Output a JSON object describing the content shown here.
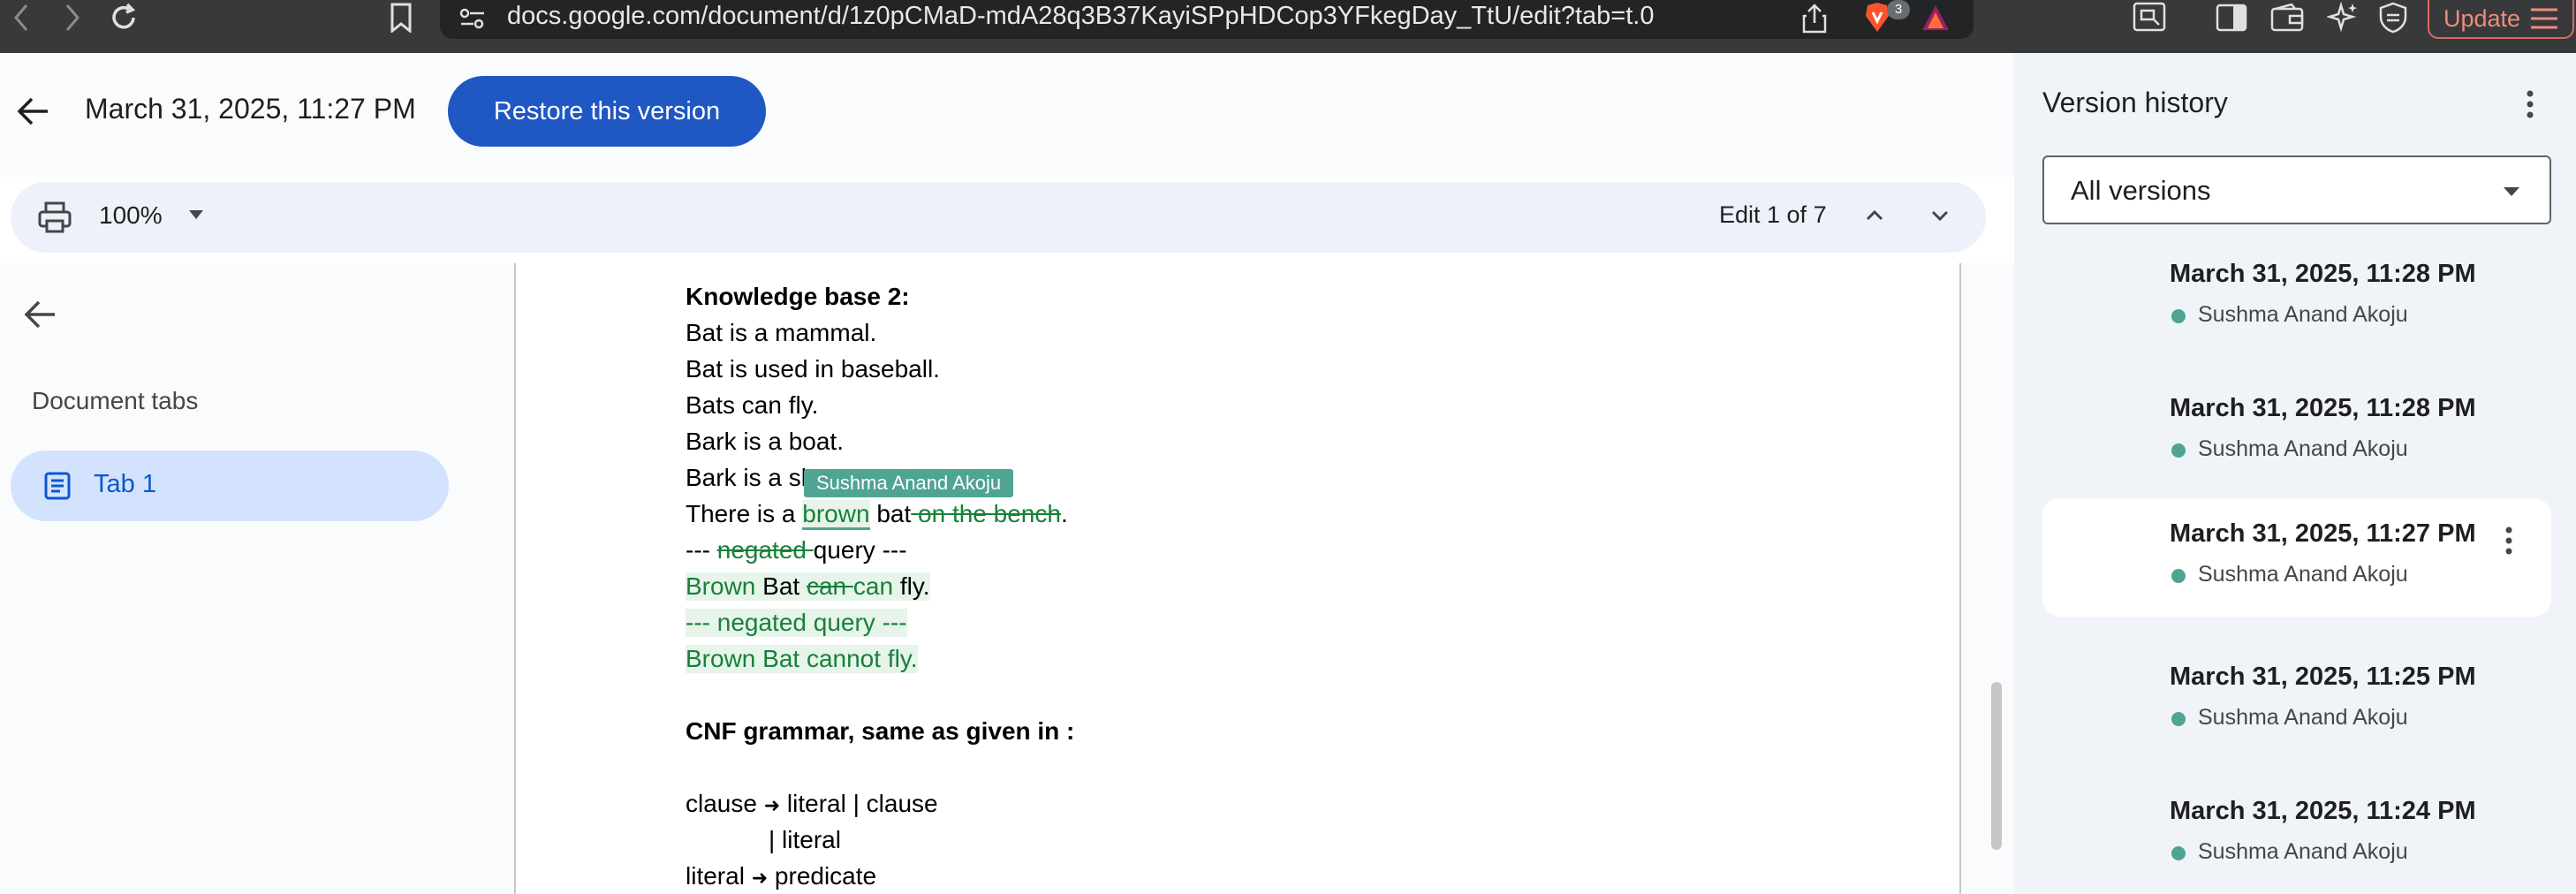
{
  "browser": {
    "url": "docs.google.com/document/d/1z0pCMaD-mdA28q3B37KayiSPpHDCop3YFkegDay_TtU/edit?tab=t.0",
    "extension_badge": "3",
    "update_label": "Update"
  },
  "header": {
    "version_title": "March 31, 2025, 11:27 PM",
    "restore_label": "Restore this version"
  },
  "toolbar": {
    "zoom": "100%",
    "edit_counter": "Edit 1 of 7"
  },
  "left_panel": {
    "title": "Document tabs",
    "tabs": [
      {
        "label": "Tab 1"
      }
    ]
  },
  "document": {
    "author_flag": "Sushma Anand Akoju",
    "l1": "Knowledge base 2:",
    "l2": "Bat is a mammal.",
    "l3": "Bat is used in baseball.",
    "l4": "Bats can fly.",
    "l5": "Bark is a boat.",
    "l6": "Bark is a sl",
    "l7_a": "There is a ",
    "l7_ins": "brown",
    "l7_b": " bat",
    "l7_del": " on the bench",
    "l7_c": ".",
    "l8_a": "--- ",
    "l8_del": "negated ",
    "l8_b": "query ---",
    "l9_ins1": "Brown",
    "l9_a": " Bat ",
    "l9_del": "can ",
    "l9_ins2": "can",
    "l9_b": " fly.",
    "l10": "--- negated query ---",
    "l11": "Brown Bat cannot fly.",
    "l12": "CNF grammar, same as given in :",
    "l13_a": "clause ",
    "l13_arrow": "➜",
    "l13_b": " literal | clause",
    "l14": "| literal",
    "l15_a": "literal ",
    "l15_arrow": "➜",
    "l15_b": " predicate"
  },
  "version_history": {
    "title": "Version history",
    "filter": "All versions",
    "items": [
      {
        "time": "March 31, 2025, 11:28 PM",
        "author": "Sushma Anand Akoju"
      },
      {
        "time": "March 31, 2025, 11:28 PM",
        "author": "Sushma Anand Akoju"
      },
      {
        "time": "March 31, 2025, 11:27 PM",
        "author": "Sushma Anand Akoju"
      },
      {
        "time": "March 31, 2025, 11:25 PM",
        "author": "Sushma Anand Akoju"
      },
      {
        "time": "March 31, 2025, 11:24 PM",
        "author": "Sushma Anand Akoju"
      }
    ]
  },
  "colors": {
    "primary": "#1f57c3",
    "author": "#4fa492",
    "insert": "#188038",
    "selected_tab": "#d3e3fd"
  }
}
